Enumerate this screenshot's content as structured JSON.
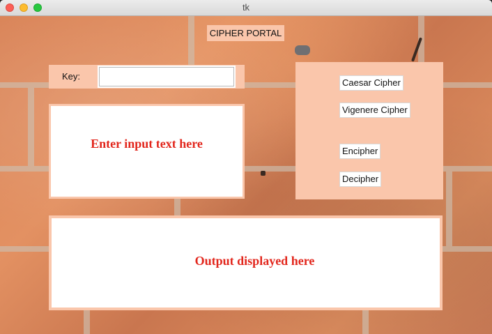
{
  "window": {
    "title": "tk"
  },
  "header": {
    "label": "CIPHER PORTAL"
  },
  "key": {
    "label": "Key:",
    "value": ""
  },
  "input": {
    "placeholder_text": "Enter input text here"
  },
  "buttons": {
    "caesar": "Caesar Cipher",
    "vigenere": "Vigenere Cipher",
    "encipher": "Encipher",
    "decipher": "Decipher"
  },
  "output": {
    "placeholder_text": "Output displayed here"
  },
  "colors": {
    "panel": "#fac6ab",
    "accent_text": "#e2261c"
  }
}
